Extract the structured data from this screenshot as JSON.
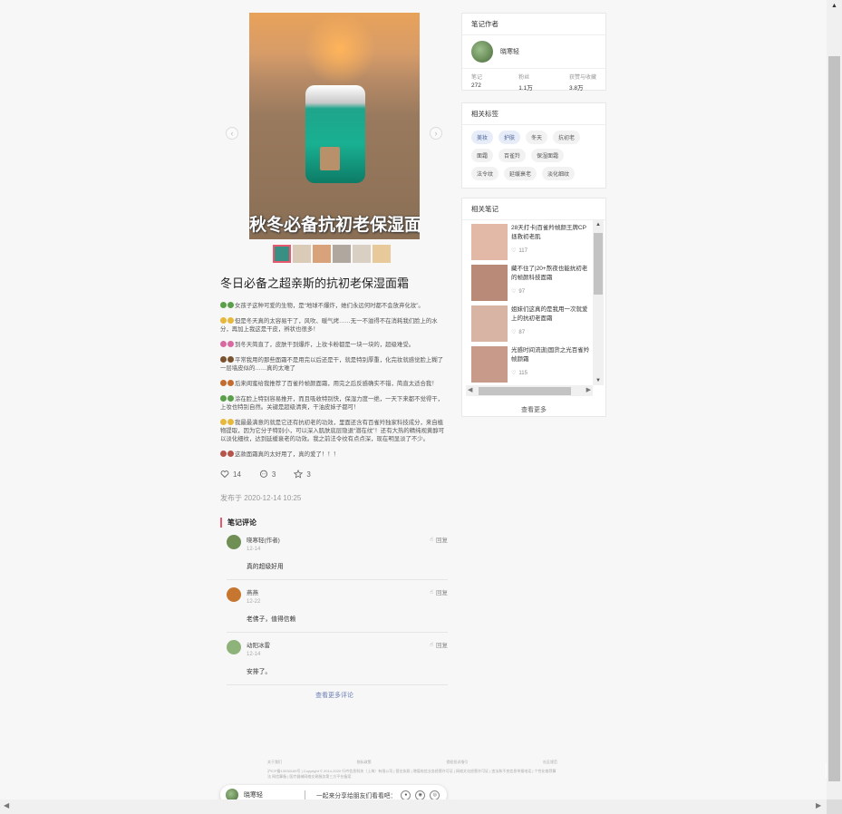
{
  "photo": {
    "caption": "秋冬必备抗初老保湿面霜",
    "thumb_colors": [
      "#3a8f84",
      "#d9cbb8",
      "#d8a27a",
      "#b0a89f",
      "#d9cfc3",
      "#e8c99a"
    ]
  },
  "note": {
    "title": "冬日必备之超亲斯的抗初老保湿面霜",
    "paragraphs": [
      {
        "emoji_color": "#5aa04a",
        "text": "女孩子这种可爱的生物，是“地球不爆炸，她们永远何时都不会放弃化妆”。"
      },
      {
        "emoji_color": "#e6b83b",
        "text": "但是冬天真的太容易干了，风吹、暖气烤……无一不滋得不在消耗我们脸上的水分，再加上我这是干皮，辨状也很多！"
      },
      {
        "emoji_color": "#d86aa1",
        "text": "到冬天简直了，皮肤干到爆炸，上妆卡粉都是一块一块的，超级难受。"
      },
      {
        "emoji_color": "#7a5230",
        "text": "平常我用的那些面霜不是用完以后还是干，就是特别厚重，化完妆就感觉脸上糊了一层墙皮似的……真的太难了"
      },
      {
        "emoji_color": "#c46b2e",
        "text": "后来闺蜜给我推荐了百雀羚帧颜面霜，用完之后反感确实不错，简直太适合我！"
      },
      {
        "emoji_color": "#5aa04a",
        "text": "涂在脸上特别容易推开，而且吸收特别快，保湿力度一绝，一天下来都不觉得干，上妆也特别自然。关键是超级清爽，干油皮妹子都可！"
      },
      {
        "emoji_color": "#e6b83b",
        "text": "我最最满意的就是它还有抗初老的功效，里面还含有百雀羚独家科技成分，来自植物提取，因为它分子特别小，可以深入肌肤底层隐退“潜在纹”！还有大热的精纯视黄醇可以淡化细纹，达到延缓衰老的功效。我之前法令纹有点点深，现在明显淡了不少。"
      },
      {
        "emoji_color": "#b5544a",
        "text": "这款面霜真的太好用了，真的爱了！！！"
      }
    ],
    "likes": "14",
    "comments_count": "3",
    "collects": "3",
    "publish_time": "发布于 2020-12-14 10:25"
  },
  "comments": {
    "heading": "笔记评论",
    "reply_label": "回复",
    "more_label": "查看更多评论",
    "items": [
      {
        "name": "晓寒轻(作者)",
        "date": "12-14",
        "text": "真的超级好用",
        "avatar": "#6f8f55"
      },
      {
        "name": "燕燕",
        "date": "12-22",
        "text": "老佛子，值得信赖",
        "avatar": "#c7762f"
      },
      {
        "name": "动阳冰雷",
        "date": "12-14",
        "text": "安排了。",
        "avatar": "#8db37a"
      }
    ]
  },
  "author": {
    "heading": "笔记作者",
    "name": "晓寒轻",
    "stats": [
      {
        "label": "笔记",
        "value": "272"
      },
      {
        "label": "粉丝",
        "value": "1.1万"
      },
      {
        "label": "获赞与收藏",
        "value": "3.8万"
      }
    ]
  },
  "tags": {
    "heading": "相关标签",
    "items": [
      {
        "label": "美妆",
        "highlight": true
      },
      {
        "label": "护肤",
        "highlight": true
      },
      {
        "label": "冬天",
        "highlight": false
      },
      {
        "label": "抗初老",
        "highlight": false
      },
      {
        "label": "面霜",
        "highlight": false
      },
      {
        "label": "百雀羚",
        "highlight": false
      },
      {
        "label": "保湿面霜",
        "highlight": false
      },
      {
        "label": "法令纹",
        "highlight": false
      },
      {
        "label": "延缓衰老",
        "highlight": false
      },
      {
        "label": "淡化细纹",
        "highlight": false
      }
    ]
  },
  "related": {
    "heading": "相关笔记",
    "see_more": "查看更多",
    "items": [
      {
        "title": "28天打卡|百雀羚帧颜王牌CP拯救初老肌",
        "likes": "117",
        "color": "#e2b9a6"
      },
      {
        "title": "藏不住了|20+熬夜也能抗初老的帧颜科技面霜",
        "likes": "97",
        "color": "#b98a77"
      },
      {
        "title": "姐妹们这真的是我用一次就爱上的抗初老面霜",
        "likes": "87",
        "color": "#d7b4a3"
      },
      {
        "title": "光感时间流逝|国货之光百雀羚帧颜霜",
        "likes": "115",
        "color": "#c79a8a"
      }
    ]
  },
  "footer": {
    "links": [
      "关于我们",
      "隐私政策",
      "侵权投诉指引",
      "社区规范"
    ],
    "text": "沪ICP备13030189号 | Copyright © 2014-2020 行吟信息科技（上海）有限公司 | 营业执照 | 增值电信业务经营许可证 | 网络文化经营许可证 | 违法和不良信息举报电话 | 个性化推荐算法 网信算备 | 医疗器械网络交易服务第三方平台备案"
  },
  "share": {
    "name": "晓寒轻",
    "prompt": "一起来分享给朋友们看看吧："
  }
}
